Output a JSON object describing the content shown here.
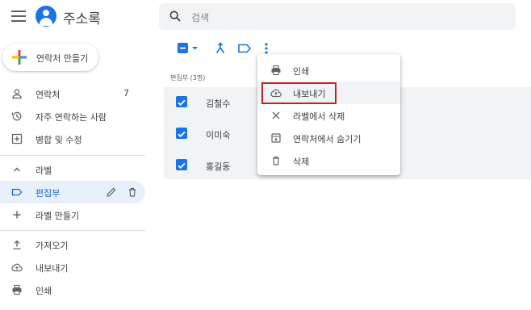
{
  "header": {
    "app_title": "주소록",
    "search_placeholder": "검색"
  },
  "sidebar": {
    "create_label": "연락처 만들기",
    "items": [
      {
        "label": "연락처",
        "count": "7",
        "icon": "person-icon"
      },
      {
        "label": "자주 연락하는 사람",
        "icon": "history-icon"
      },
      {
        "label": "병합 및 수정",
        "icon": "merge-fix-icon"
      }
    ],
    "labels_header": "라벨",
    "label_items": [
      {
        "label": "편집부",
        "icon": "label-icon",
        "active": true
      }
    ],
    "create_label_item": "라벨 만들기",
    "bottom_items": [
      {
        "label": "가져오기",
        "icon": "upload-icon"
      },
      {
        "label": "내보내기",
        "icon": "cloud-upload-icon"
      },
      {
        "label": "인쇄",
        "icon": "print-icon"
      }
    ]
  },
  "main": {
    "group_header": "편집부 (3명)",
    "contacts": [
      {
        "name": "김철수",
        "checked": true
      },
      {
        "name": "이미숙",
        "checked": true
      },
      {
        "name": "홍길동",
        "checked": true
      }
    ]
  },
  "menu": {
    "items": [
      {
        "label": "인쇄",
        "icon": "print-icon"
      },
      {
        "label": "내보내기",
        "icon": "cloud-upload-icon",
        "highlighted": true
      },
      {
        "label": "라벨에서 삭제",
        "icon": "close-icon"
      },
      {
        "label": "연락처에서 숨기기",
        "icon": "archive-icon"
      },
      {
        "label": "삭제",
        "icon": "trash-icon"
      }
    ]
  },
  "colors": {
    "accent": "#1a73e8",
    "active_bg": "#e8f0fe",
    "highlight_border": "#c5221f"
  }
}
